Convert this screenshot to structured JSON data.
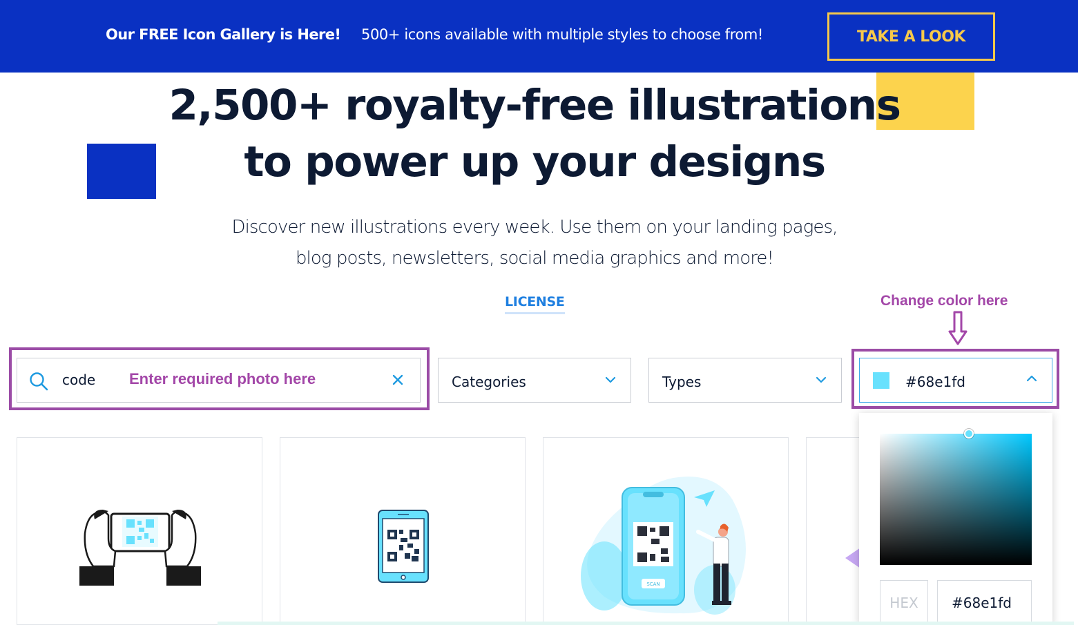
{
  "banner": {
    "headline": "Our FREE Icon Gallery is Here!",
    "text": "500+ icons available with multiple styles to choose from!",
    "cta": "TAKE A LOOK"
  },
  "hero": {
    "title_line1": "2,500+ royalty-free illustrations",
    "title_line2": "to power up your designs",
    "subtitle_line1": "Discover new illustrations every week. Use them on your landing pages,",
    "subtitle_line2": "blog posts, newsletters, social media graphics and more!"
  },
  "license_link": "LICENSE",
  "annotations": {
    "color": "Change color here",
    "search": "Enter required photo here"
  },
  "filters": {
    "search": {
      "value": "code",
      "icon": "search-icon",
      "clear_icon": "close-icon"
    },
    "categories": "Categories",
    "types": "Types",
    "color": {
      "value": "#68e1fd",
      "swatch": "#68e1fd"
    }
  },
  "color_picker": {
    "hex_label": "HEX",
    "hex_value": "#68e1fd",
    "hue": "#00c8ff"
  },
  "cards": [
    {
      "name": "hands-holding-phone-qr-illustration"
    },
    {
      "name": "phone-qr-code-illustration"
    },
    {
      "name": "person-scanning-qr-illustration",
      "badge": "SCAN"
    },
    {
      "name": "partial-illustration"
    }
  ],
  "colors": {
    "banner_bg": "#0a31c2",
    "accent_yellow": "#f7c94a",
    "annotation_purple": "#a347a8",
    "link_blue": "#1e7fe0",
    "illustration_cyan": "#68e1fd"
  }
}
